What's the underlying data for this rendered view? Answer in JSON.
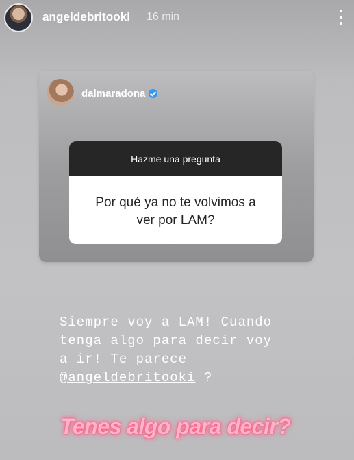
{
  "header": {
    "username": "angeldebritooki",
    "time": "16 min",
    "avatar_icon": "profile-photo-icon",
    "more_icon": "more-vertical-icon"
  },
  "card": {
    "username": "dalmaradona",
    "verified_icon": "verified-badge-icon",
    "verified_color": "#3897f0"
  },
  "sticker": {
    "title": "Hazme una pregunta",
    "question_line1": "Por qué ya no te volvimos a",
    "question_line2": "ver por LAM?"
  },
  "reply": {
    "line1": "Siempre voy a LAM! Cuando",
    "line2": "tenga algo para decir voy",
    "line3": "a ir! Te parece",
    "mention": "@angeldebritooki",
    "line4_suffix": " ?"
  },
  "bottom": {
    "text": "Tenes algo para decir?",
    "color": "#ff5e8a"
  }
}
